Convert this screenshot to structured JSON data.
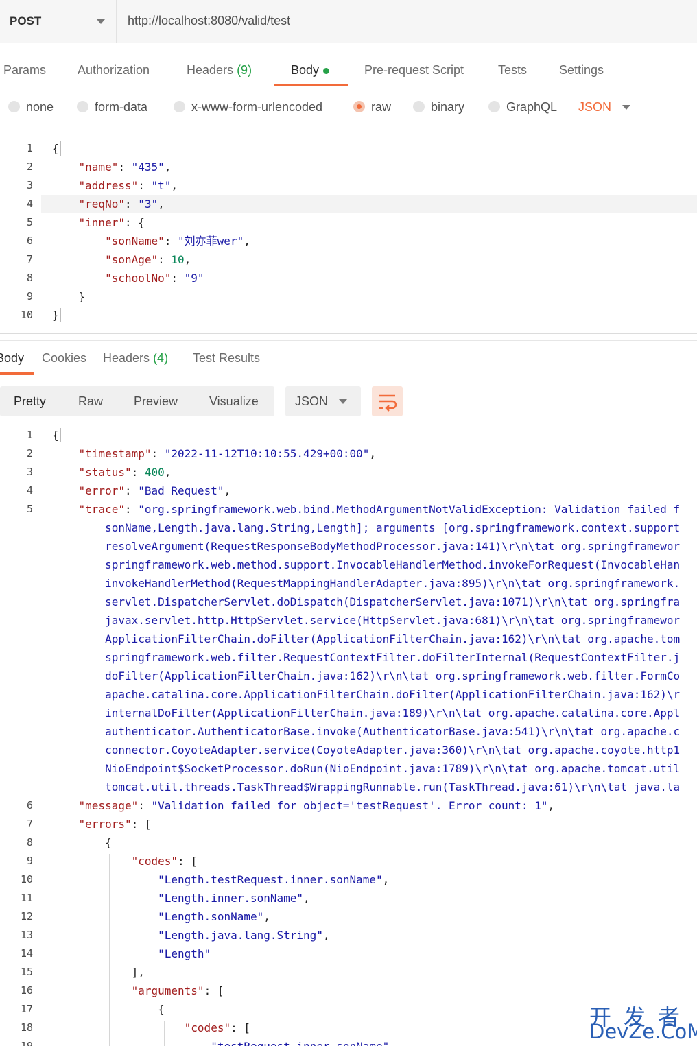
{
  "request": {
    "method": "POST",
    "url": "http://localhost:8080/valid/test",
    "tabs": {
      "params": "Params",
      "authorization": "Authorization",
      "headers": "Headers",
      "headers_count": "(9)",
      "body": "Body",
      "prerequest": "Pre-request Script",
      "tests": "Tests",
      "settings": "Settings"
    },
    "body_types": {
      "none": "none",
      "form_data": "form-data",
      "urlencoded": "x-www-form-urlencoded",
      "raw": "raw",
      "binary": "binary",
      "graphql": "GraphQL",
      "json": "JSON",
      "selected": "raw"
    },
    "body_lines": [
      [
        {
          "t": "{",
          "c": "p"
        }
      ],
      [
        {
          "t": "    ",
          "c": "p"
        },
        {
          "t": "\"name\"",
          "c": "k"
        },
        {
          "t": ": ",
          "c": "p"
        },
        {
          "t": "\"435\"",
          "c": "s"
        },
        {
          "t": ",",
          "c": "p"
        }
      ],
      [
        {
          "t": "    ",
          "c": "p"
        },
        {
          "t": "\"address\"",
          "c": "k"
        },
        {
          "t": ": ",
          "c": "p"
        },
        {
          "t": "\"t\"",
          "c": "s"
        },
        {
          "t": ",",
          "c": "p"
        }
      ],
      [
        {
          "t": "    ",
          "c": "p"
        },
        {
          "t": "\"reqNo\"",
          "c": "k"
        },
        {
          "t": ": ",
          "c": "p"
        },
        {
          "t": "\"3\"",
          "c": "s"
        },
        {
          "t": ",",
          "c": "p"
        }
      ],
      [
        {
          "t": "    ",
          "c": "p"
        },
        {
          "t": "\"inner\"",
          "c": "k"
        },
        {
          "t": ": {",
          "c": "p"
        }
      ],
      [
        {
          "t": "        ",
          "c": "p"
        },
        {
          "t": "\"sonName\"",
          "c": "k"
        },
        {
          "t": ": ",
          "c": "p"
        },
        {
          "t": "\"刘亦菲wer\"",
          "c": "s"
        },
        {
          "t": ",",
          "c": "p"
        }
      ],
      [
        {
          "t": "        ",
          "c": "p"
        },
        {
          "t": "\"sonAge\"",
          "c": "k"
        },
        {
          "t": ": ",
          "c": "p"
        },
        {
          "t": "10",
          "c": "n"
        },
        {
          "t": ",",
          "c": "p"
        }
      ],
      [
        {
          "t": "        ",
          "c": "p"
        },
        {
          "t": "\"schoolNo\"",
          "c": "k"
        },
        {
          "t": ": ",
          "c": "p"
        },
        {
          "t": "\"9\"",
          "c": "s"
        }
      ],
      [
        {
          "t": "    }",
          "c": "p"
        }
      ],
      [
        {
          "t": "}",
          "c": "p"
        }
      ]
    ]
  },
  "response": {
    "tabs": {
      "body": "Body",
      "cookies": "Cookies",
      "headers": "Headers",
      "headers_count": "(4)",
      "test_results": "Test Results"
    },
    "formats": {
      "pretty": "Pretty",
      "raw": "Raw",
      "preview": "Preview",
      "visualize": "Visualize",
      "lang": "JSON"
    },
    "body_lines": [
      {
        "n": "1",
        "seg": [
          {
            "t": "{",
            "c": "p"
          }
        ]
      },
      {
        "n": "2",
        "seg": [
          {
            "t": "    ",
            "c": "p"
          },
          {
            "t": "\"timestamp\"",
            "c": "k"
          },
          {
            "t": ": ",
            "c": "p"
          },
          {
            "t": "\"2022-11-12T10:10:55.429+00:00\"",
            "c": "s"
          },
          {
            "t": ",",
            "c": "p"
          }
        ]
      },
      {
        "n": "3",
        "seg": [
          {
            "t": "    ",
            "c": "p"
          },
          {
            "t": "\"status\"",
            "c": "k"
          },
          {
            "t": ": ",
            "c": "p"
          },
          {
            "t": "400",
            "c": "n"
          },
          {
            "t": ",",
            "c": "p"
          }
        ]
      },
      {
        "n": "4",
        "seg": [
          {
            "t": "    ",
            "c": "p"
          },
          {
            "t": "\"error\"",
            "c": "k"
          },
          {
            "t": ": ",
            "c": "p"
          },
          {
            "t": "\"Bad Request\"",
            "c": "s"
          },
          {
            "t": ",",
            "c": "p"
          }
        ]
      },
      {
        "n": "5",
        "seg": [
          {
            "t": "    ",
            "c": "p"
          },
          {
            "t": "\"trace\"",
            "c": "k"
          },
          {
            "t": ": ",
            "c": "p"
          },
          {
            "t": "\"org.springframework.web.bind.MethodArgumentNotValidException: Validation failed f",
            "c": "s"
          }
        ]
      },
      {
        "n": "",
        "seg": [
          {
            "t": "        sonName,Length.java.lang.String,Length]; arguments [org.springframework.context.support",
            "c": "s"
          }
        ]
      },
      {
        "n": "",
        "seg": [
          {
            "t": "        resolveArgument(RequestResponseBodyMethodProcessor.java:141)\\r\\n\\tat org.springframewor",
            "c": "s"
          }
        ]
      },
      {
        "n": "",
        "seg": [
          {
            "t": "        springframework.web.method.support.InvocableHandlerMethod.invokeForRequest(InvocableHan",
            "c": "s"
          }
        ]
      },
      {
        "n": "",
        "seg": [
          {
            "t": "        invokeHandlerMethod(RequestMappingHandlerAdapter.java:895)\\r\\n\\tat org.springframework.",
            "c": "s"
          }
        ]
      },
      {
        "n": "",
        "seg": [
          {
            "t": "        servlet.DispatcherServlet.doDispatch(DispatcherServlet.java:1071)\\r\\n\\tat org.springfra",
            "c": "s"
          }
        ]
      },
      {
        "n": "",
        "seg": [
          {
            "t": "        javax.servlet.http.HttpServlet.service(HttpServlet.java:681)\\r\\n\\tat org.springframewor",
            "c": "s"
          }
        ]
      },
      {
        "n": "",
        "seg": [
          {
            "t": "        ApplicationFilterChain.doFilter(ApplicationFilterChain.java:162)\\r\\n\\tat org.apache.tom",
            "c": "s"
          }
        ]
      },
      {
        "n": "",
        "seg": [
          {
            "t": "        springframework.web.filter.RequestContextFilter.doFilterInternal(RequestContextFilter.j",
            "c": "s"
          }
        ]
      },
      {
        "n": "",
        "seg": [
          {
            "t": "        doFilter(ApplicationFilterChain.java:162)\\r\\n\\tat org.springframework.web.filter.FormCo",
            "c": "s"
          }
        ]
      },
      {
        "n": "",
        "seg": [
          {
            "t": "        apache.catalina.core.ApplicationFilterChain.doFilter(ApplicationFilterChain.java:162)\\r",
            "c": "s"
          }
        ]
      },
      {
        "n": "",
        "seg": [
          {
            "t": "        internalDoFilter(ApplicationFilterChain.java:189)\\r\\n\\tat org.apache.catalina.core.Appl",
            "c": "s"
          }
        ]
      },
      {
        "n": "",
        "seg": [
          {
            "t": "        authenticator.AuthenticatorBase.invoke(AuthenticatorBase.java:541)\\r\\n\\tat org.apache.c",
            "c": "s"
          }
        ]
      },
      {
        "n": "",
        "seg": [
          {
            "t": "        connector.CoyoteAdapter.service(CoyoteAdapter.java:360)\\r\\n\\tat org.apache.coyote.http1",
            "c": "s"
          }
        ]
      },
      {
        "n": "",
        "seg": [
          {
            "t": "        NioEndpoint$SocketProcessor.doRun(NioEndpoint.java:1789)\\r\\n\\tat org.apache.tomcat.util",
            "c": "s"
          }
        ]
      },
      {
        "n": "",
        "seg": [
          {
            "t": "        tomcat.util.threads.TaskThread$WrappingRunnable.run(TaskThread.java:61)\\r\\n\\tat java.la",
            "c": "s"
          }
        ]
      },
      {
        "n": "6",
        "seg": [
          {
            "t": "    ",
            "c": "p"
          },
          {
            "t": "\"message\"",
            "c": "k"
          },
          {
            "t": ": ",
            "c": "p"
          },
          {
            "t": "\"Validation failed for object='testRequest'. Error count: 1\"",
            "c": "s"
          },
          {
            "t": ",",
            "c": "p"
          }
        ]
      },
      {
        "n": "7",
        "seg": [
          {
            "t": "    ",
            "c": "p"
          },
          {
            "t": "\"errors\"",
            "c": "k"
          },
          {
            "t": ": [",
            "c": "p"
          }
        ]
      },
      {
        "n": "8",
        "seg": [
          {
            "t": "        {",
            "c": "p"
          }
        ]
      },
      {
        "n": "9",
        "seg": [
          {
            "t": "            ",
            "c": "p"
          },
          {
            "t": "\"codes\"",
            "c": "k"
          },
          {
            "t": ": [",
            "c": "p"
          }
        ]
      },
      {
        "n": "10",
        "seg": [
          {
            "t": "                ",
            "c": "p"
          },
          {
            "t": "\"Length.testRequest.inner.sonName\"",
            "c": "s"
          },
          {
            "t": ",",
            "c": "p"
          }
        ]
      },
      {
        "n": "11",
        "seg": [
          {
            "t": "                ",
            "c": "p"
          },
          {
            "t": "\"Length.inner.sonName\"",
            "c": "s"
          },
          {
            "t": ",",
            "c": "p"
          }
        ]
      },
      {
        "n": "12",
        "seg": [
          {
            "t": "                ",
            "c": "p"
          },
          {
            "t": "\"Length.sonName\"",
            "c": "s"
          },
          {
            "t": ",",
            "c": "p"
          }
        ]
      },
      {
        "n": "13",
        "seg": [
          {
            "t": "                ",
            "c": "p"
          },
          {
            "t": "\"Length.java.lang.String\"",
            "c": "s"
          },
          {
            "t": ",",
            "c": "p"
          }
        ]
      },
      {
        "n": "14",
        "seg": [
          {
            "t": "                ",
            "c": "p"
          },
          {
            "t": "\"Length\"",
            "c": "s"
          }
        ]
      },
      {
        "n": "15",
        "seg": [
          {
            "t": "            ],",
            "c": "p"
          }
        ]
      },
      {
        "n": "16",
        "seg": [
          {
            "t": "            ",
            "c": "p"
          },
          {
            "t": "\"arguments\"",
            "c": "k"
          },
          {
            "t": ": [",
            "c": "p"
          }
        ]
      },
      {
        "n": "17",
        "seg": [
          {
            "t": "                {",
            "c": "p"
          }
        ]
      },
      {
        "n": "18",
        "seg": [
          {
            "t": "                    ",
            "c": "p"
          },
          {
            "t": "\"codes\"",
            "c": "k"
          },
          {
            "t": ": [",
            "c": "p"
          }
        ]
      },
      {
        "n": "19",
        "seg": [
          {
            "t": "                        ",
            "c": "p"
          },
          {
            "t": "\"testRequest.inner.sonName\"",
            "c": "s"
          }
        ]
      }
    ]
  },
  "watermark": {
    "line1": "开发者",
    "line2": "DevZe.CoM"
  },
  "colors": {
    "accent": "#f26b3a",
    "green": "#26a148",
    "json_key": "#a21e1e",
    "json_string": "#1a1aa6",
    "json_number": "#098658"
  },
  "icons": {
    "method_dropdown": "chevron-down-icon",
    "json_dropdown": "chevron-down-icon",
    "wrap": "wrap-lines-icon"
  }
}
